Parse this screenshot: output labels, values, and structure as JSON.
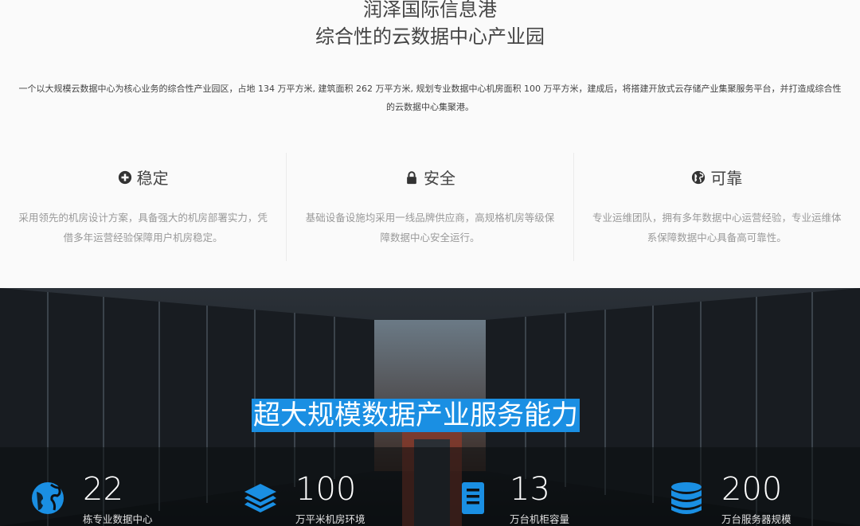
{
  "header": {
    "title_line1": "润泽国际信息港",
    "title_line2": "综合性的云数据中心产业园",
    "intro": "一个以大规模云数据中心为核心业务的综合性产业园区，占地 134 万平方米, 建筑面积 262 万平方米, 规划专业数据中心机房面积 100 万平方米，建成后，将搭建开放式云存储产业集聚服务平台，并打造成综合性的云数据中心集聚港。"
  },
  "features": [
    {
      "icon": "plus-circle-icon",
      "title": "稳定",
      "text": "采用领先的机房设计方案，具备强大的机房部署实力，凭借多年运营经验保障用户机房稳定。"
    },
    {
      "icon": "lock-icon",
      "title": "安全",
      "text": "基础设备设施均采用一线品牌供应商，高规格机房等级保障数据中心安全运行。"
    },
    {
      "icon": "globe-icon",
      "title": "可靠",
      "text": "专业运维团队，拥有多年数据中心运营经验，专业运维体系保障数据中心具备高可靠性。"
    }
  ],
  "banner": {
    "title": "超大规模数据产业服务能力",
    "accent": "#1a8fe3"
  },
  "stats": [
    {
      "icon": "globe-icon",
      "number": "22",
      "label": "栋专业数据中心"
    },
    {
      "icon": "layers-icon",
      "number": "100",
      "label": "万平米机房环境"
    },
    {
      "icon": "server-cabinet-icon",
      "number": "13",
      "label": "万台机柜容量"
    },
    {
      "icon": "database-icon",
      "number": "200",
      "label": "万台服务器规模"
    }
  ]
}
